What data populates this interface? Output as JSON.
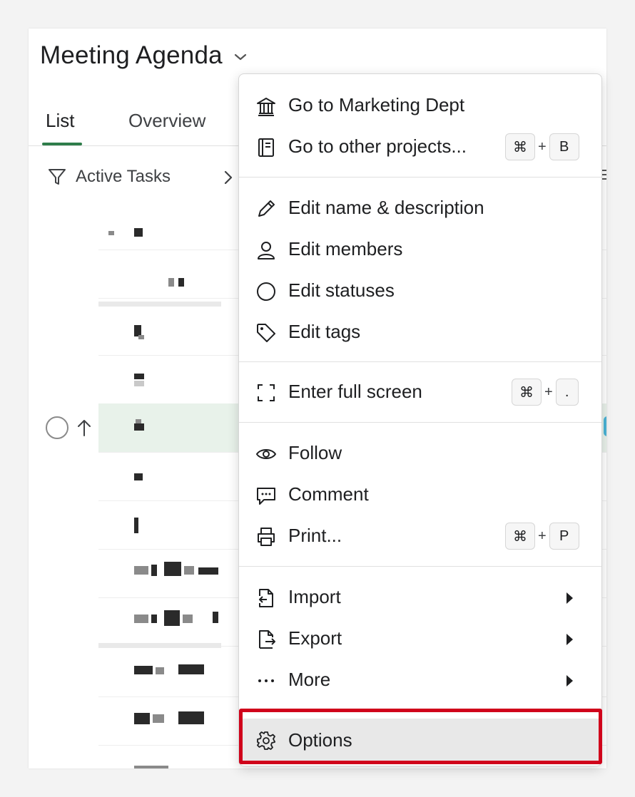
{
  "project": {
    "title": "Meeting Agenda"
  },
  "tabs": [
    {
      "label": "List"
    },
    {
      "label": "Overview"
    }
  ],
  "filter": {
    "label": "Active Tasks"
  },
  "menu": {
    "goto_dept": "Go to Marketing Dept",
    "goto_projects": "Go to other projects...",
    "goto_projects_shortcut": {
      "mod": "⌘",
      "plus": "+",
      "key": "B"
    },
    "edit_name": "Edit name & description",
    "edit_members": "Edit members",
    "edit_statuses": "Edit statuses",
    "edit_tags": "Edit tags",
    "fullscreen": "Enter full screen",
    "fullscreen_shortcut": {
      "mod": "⌘",
      "plus": "+",
      "key": "."
    },
    "follow": "Follow",
    "comment": "Comment",
    "print": "Print...",
    "print_shortcut": {
      "mod": "⌘",
      "plus": "+",
      "key": "P"
    },
    "import": "Import",
    "export": "Export",
    "more": "More",
    "options": "Options"
  },
  "colors": {
    "tab_underline": "#2e7d4a",
    "highlight_row": "#e8f2ea",
    "annotation_box": "#d0021b"
  },
  "icons": [
    "chevron-down-icon",
    "filter-icon",
    "chevron-right-icon",
    "bank-icon",
    "notebook-icon",
    "pencil-icon",
    "user-icon",
    "circle-icon",
    "tag-icon",
    "fullscreen-icon",
    "eye-icon",
    "comment-icon",
    "printer-icon",
    "file-import-icon",
    "file-export-icon",
    "more-dots-icon",
    "caret-right-icon",
    "gear-icon",
    "checkbox-circle-icon",
    "arrow-up-icon"
  ]
}
